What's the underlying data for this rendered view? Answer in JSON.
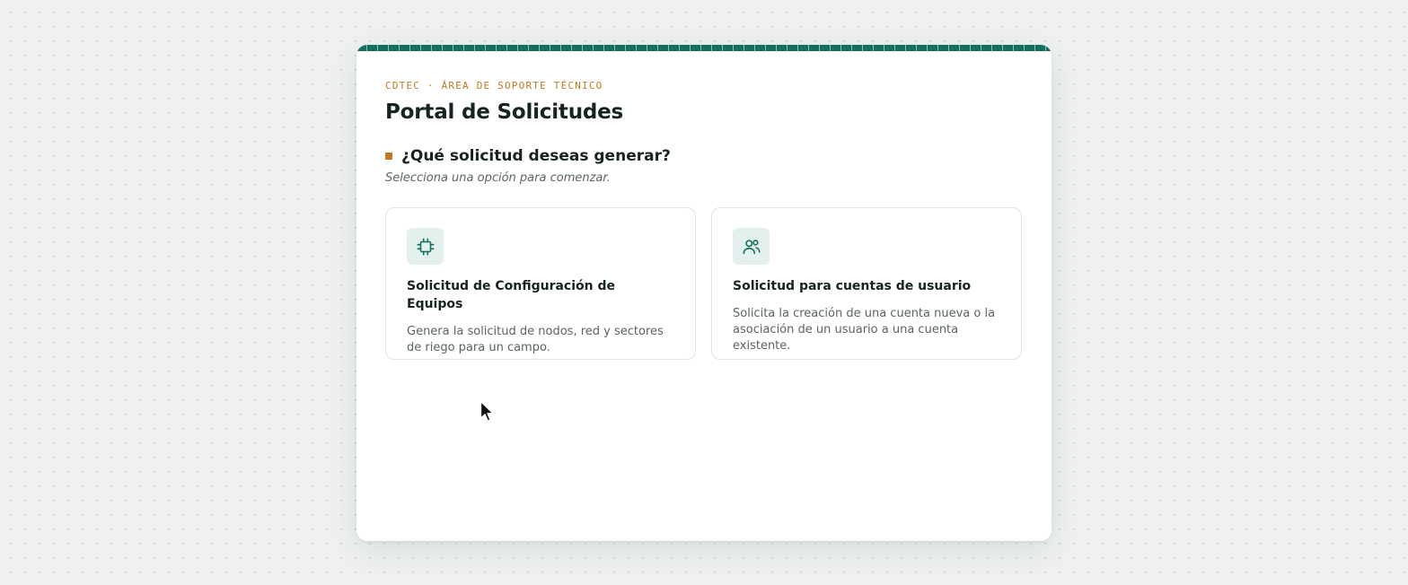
{
  "header": {
    "eyebrow": "CDTEC · ÁREA DE SOPORTE TÉCNICO",
    "title": "Portal de Solicitudes"
  },
  "prompt": {
    "question": "¿Qué solicitud deseas generar?",
    "subtitle": "Selecciona una opción para comenzar."
  },
  "options": [
    {
      "icon": "chip-icon",
      "title": "Solicitud de Configuración de Equipos",
      "description": "Genera la solicitud de nodos, red y sectores de riego para un campo."
    },
    {
      "icon": "users-icon",
      "title": "Solicitud para cuentas de usuario",
      "description": "Solicita la creación de una cuenta nueva o la asociación de un usuario a una cuenta existente."
    }
  ],
  "colors": {
    "accent_green": "#11705e",
    "accent_orange": "#c07a1e",
    "icon_bg": "#e3f0ed",
    "text_dark": "#16241f",
    "text_muted": "#5a6561"
  }
}
